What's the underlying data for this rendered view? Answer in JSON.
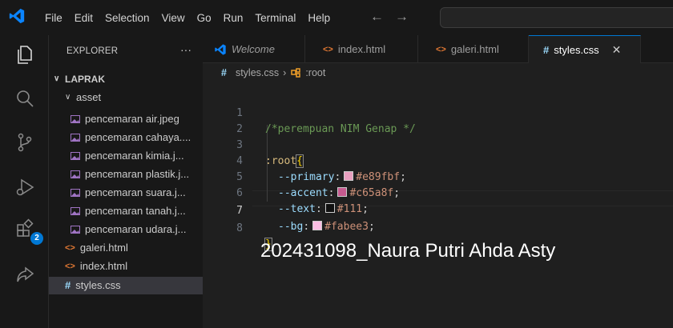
{
  "menu": [
    "File",
    "Edit",
    "Selection",
    "View",
    "Go",
    "Run",
    "Terminal",
    "Help"
  ],
  "nav": {
    "back": "←",
    "forward": "→"
  },
  "explorer": {
    "title": "EXPLORER",
    "more": "···",
    "root": "LAPRAK",
    "folder": "asset",
    "files_in_folder": [
      "pencemaran air.jpeg",
      "pencemaran cahaya....",
      "pencemaran kimia.j...",
      "pencemaran plastik.j...",
      "pencemaran suara.j...",
      "pencemaran tanah.j...",
      "pencemaran udara.j..."
    ],
    "root_files": [
      "galeri.html",
      "index.html",
      "styles.css"
    ],
    "badge_count": "2"
  },
  "tabs": [
    {
      "label": "Welcome",
      "icon": "vscode-logo-icon"
    },
    {
      "label": "index.html",
      "icon": "html-file-icon"
    },
    {
      "label": "galeri.html",
      "icon": "html-file-icon"
    },
    {
      "label": "styles.css",
      "icon": "css-file-icon",
      "active": true,
      "close": "✕"
    }
  ],
  "breadcrumb": {
    "file": "styles.css",
    "sep": "›",
    "symbol": ":root",
    "hash": "#"
  },
  "editor": {
    "lines": [
      "1",
      "2",
      "3",
      "4",
      "5",
      "6",
      "7",
      "8"
    ],
    "comment": "/*perempuan NIM Genap */",
    "root_selector": ":root",
    "open_brace": "{",
    "close_brace": "}",
    "vars": [
      {
        "name": "--primary",
        "value": "#e89fbf",
        "color": "#e89fbf"
      },
      {
        "name": "--accent",
        "value": "#c65a8f",
        "color": "#c65a8f"
      },
      {
        "name": "--text",
        "value": "#111",
        "color": "#111111"
      },
      {
        "name": "--bg",
        "value": "#fabee3",
        "color": "#fabee3"
      }
    ]
  },
  "caption": "202431098_Naura Putri Ahda Asty",
  "colors": {
    "accent": "#0078d4",
    "background": "#1f1f1f"
  }
}
